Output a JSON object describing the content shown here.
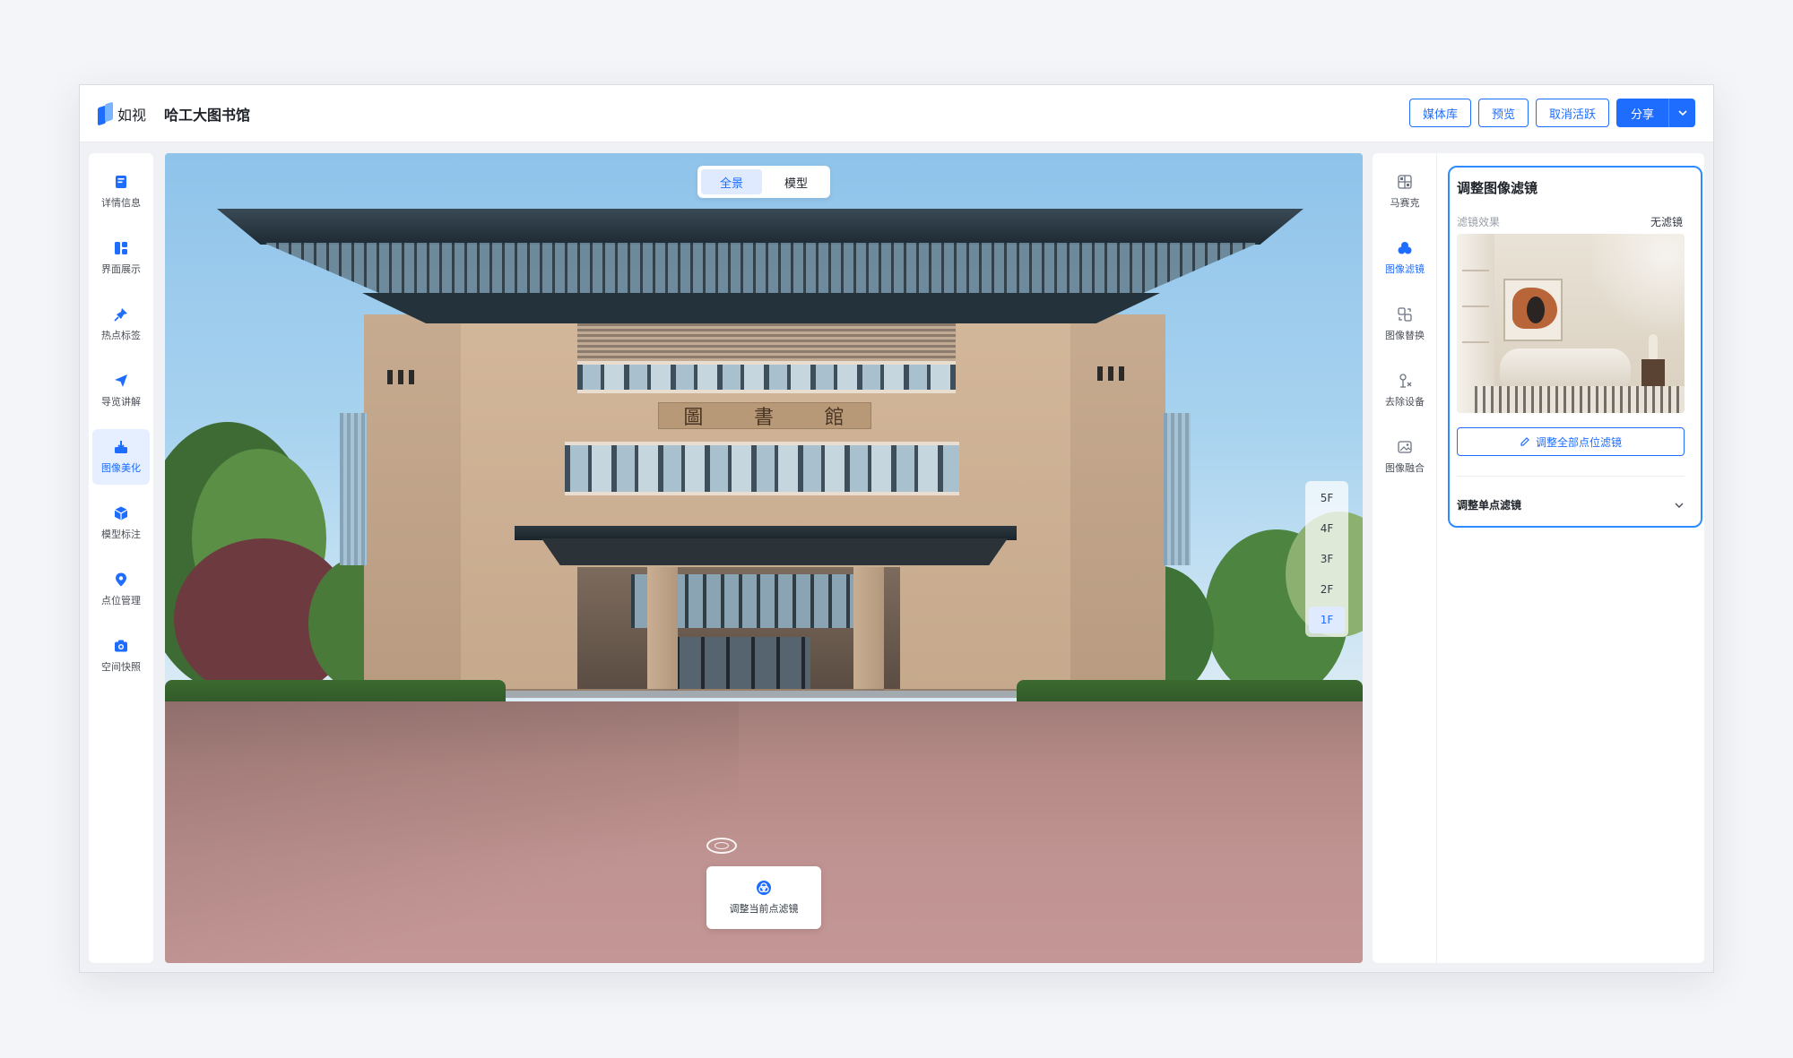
{
  "header": {
    "logo_text": "如视",
    "project_title": "哈工大图书馆",
    "buttons": {
      "media_library": "媒体库",
      "preview": "预览",
      "cancel_activate": "取消活跃",
      "share": "分享"
    }
  },
  "left_nav": {
    "items": [
      {
        "label": "详情信息",
        "icon": "document-icon"
      },
      {
        "label": "界面展示",
        "icon": "layout-icon"
      },
      {
        "label": "热点标签",
        "icon": "pin-icon"
      },
      {
        "label": "导览讲解",
        "icon": "send-icon"
      },
      {
        "label": "图像美化",
        "icon": "beautify-icon",
        "active": true
      },
      {
        "label": "模型标注",
        "icon": "cube-icon"
      },
      {
        "label": "点位管理",
        "icon": "location-icon"
      },
      {
        "label": "空间快照",
        "icon": "camera-icon"
      }
    ]
  },
  "viewer": {
    "toggle": {
      "panorama": "全景",
      "model": "模型",
      "active": "panorama"
    },
    "building_sign": [
      "圖",
      "書",
      "館"
    ],
    "floors": [
      "5F",
      "4F",
      "3F",
      "2F",
      "1F"
    ],
    "active_floor": "1F",
    "adjust_current_filter": "调整当前点滤镜"
  },
  "tool_rail": {
    "items": [
      {
        "label": "马赛克",
        "icon": "mosaic-icon"
      },
      {
        "label": "图像滤镜",
        "icon": "filter-icon",
        "active": true
      },
      {
        "label": "图像替换",
        "icon": "replace-icon"
      },
      {
        "label": "去除设备",
        "icon": "remove-device-icon"
      },
      {
        "label": "图像融合",
        "icon": "image-merge-icon"
      }
    ]
  },
  "filter_panel": {
    "title": "调整图像滤镜",
    "effect_label": "滤镜效果",
    "effect_value": "无滤镜",
    "adjust_all_button": "调整全部点位滤镜",
    "single_point_label": "调整单点滤镜"
  },
  "colors": {
    "accent": "#1e6dff",
    "active_bg": "#e5efff",
    "panel_border": "#2e8bff"
  }
}
